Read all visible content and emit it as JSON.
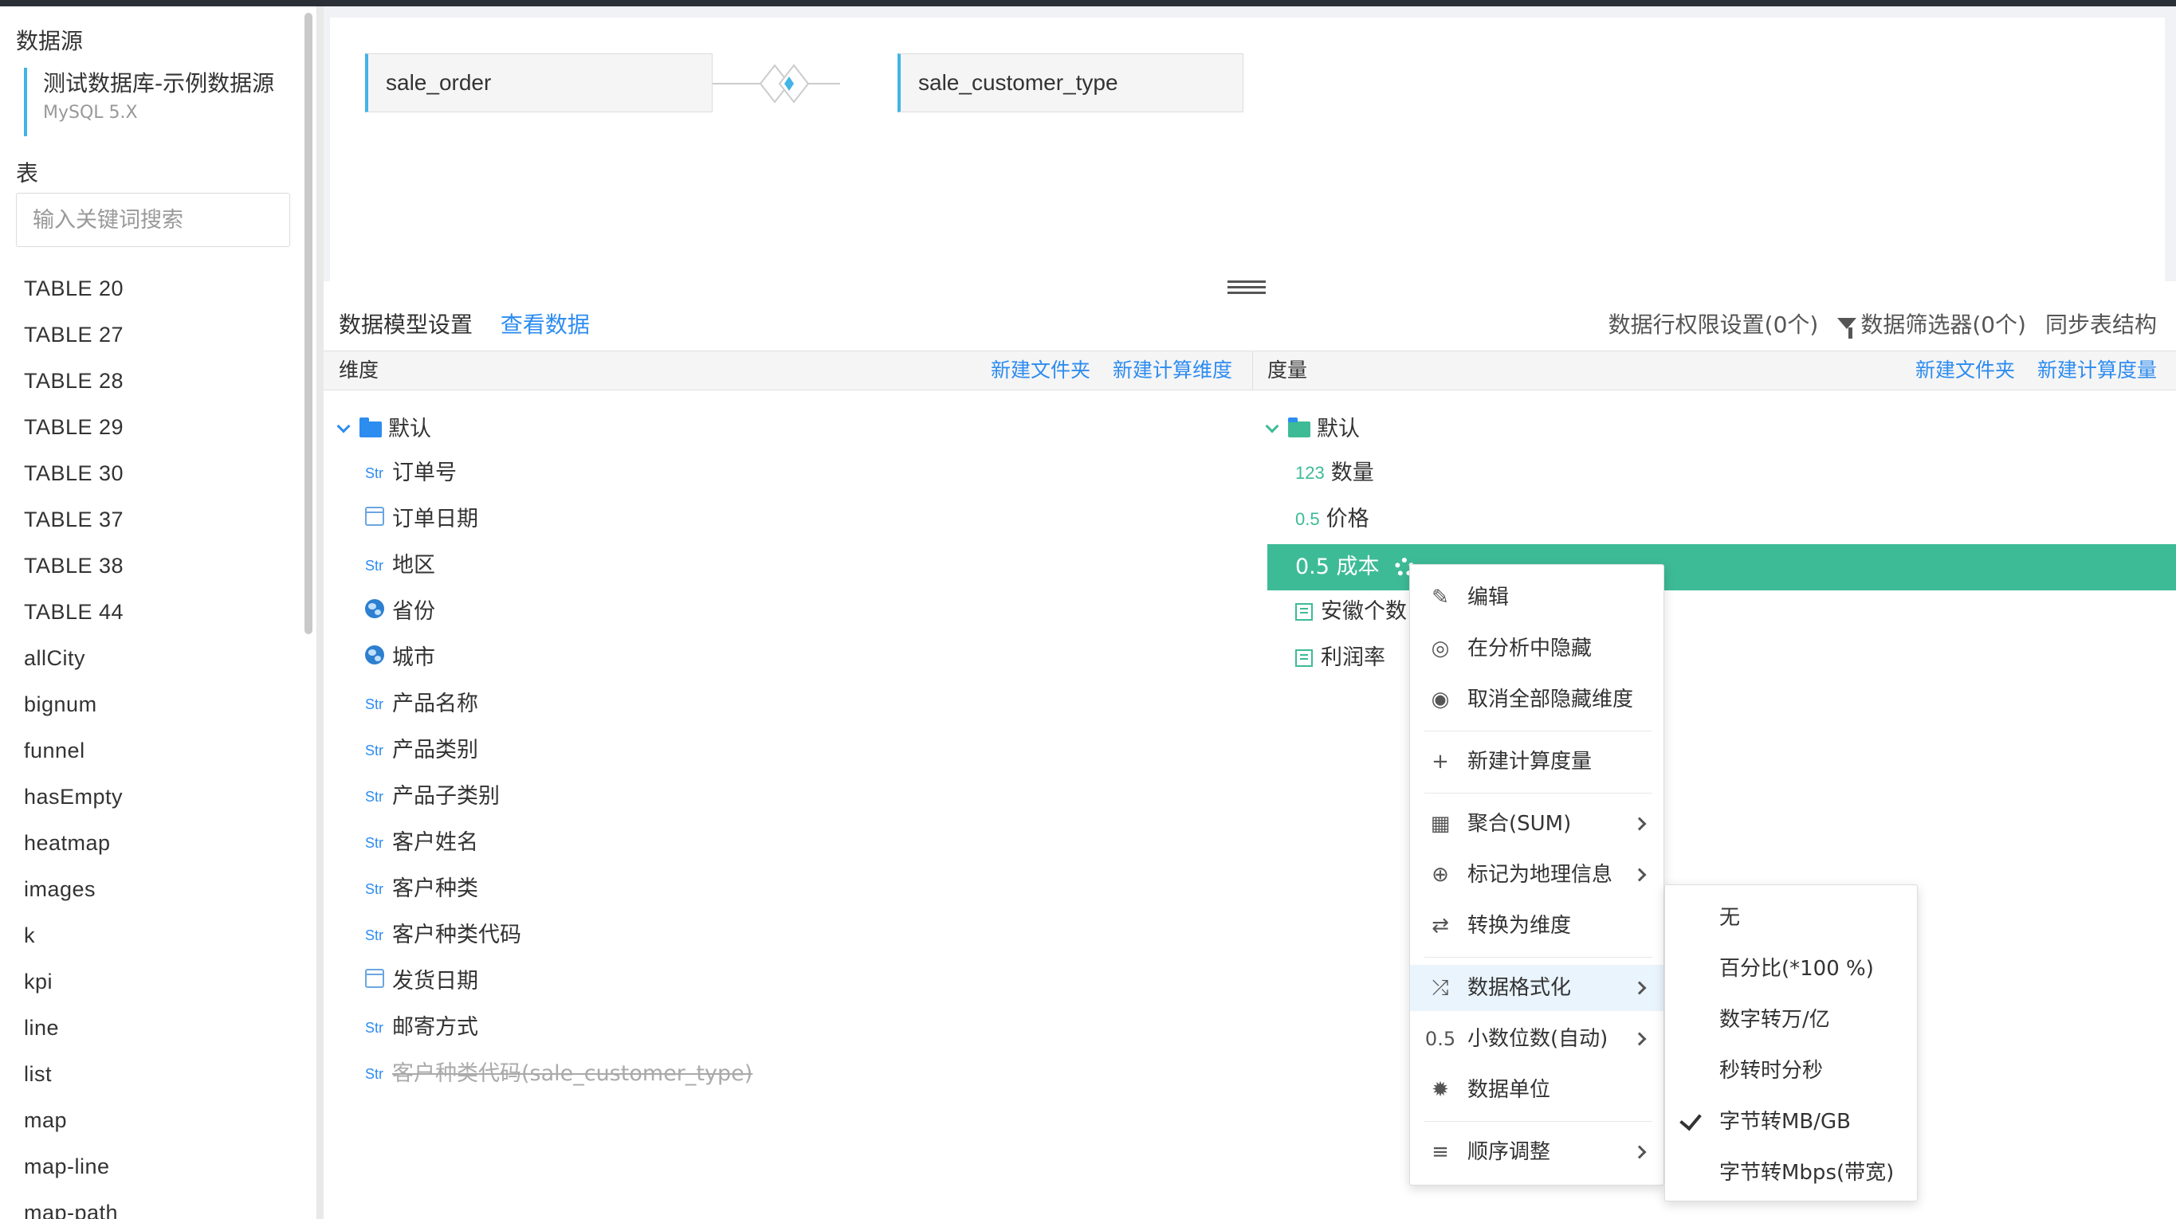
{
  "sidebar": {
    "datasource_title": "数据源",
    "datasource_name": "测试数据库-示例数据源",
    "datasource_version": "MySQL 5.X",
    "table_title": "表",
    "search_placeholder": "输入关键词搜索",
    "tables": [
      "TABLE 20",
      "TABLE 27",
      "TABLE 28",
      "TABLE 29",
      "TABLE 30",
      "TABLE 37",
      "TABLE 38",
      "TABLE 44",
      "allCity",
      "bignum",
      "funnel",
      "hasEmpty",
      "heatmap",
      "images",
      "k",
      "kpi",
      "line",
      "list",
      "map",
      "map-line",
      "map-path"
    ]
  },
  "canvas": {
    "left_table": "sale_order",
    "right_table": "sale_customer_type"
  },
  "tabs": {
    "model_settings": "数据模型设置",
    "view_data": "查看数据"
  },
  "toplinks": {
    "row_permission": "数据行权限设置(0个)",
    "filter": "数据筛选器(0个)",
    "sync": "同步表结构"
  },
  "dimensions": {
    "title": "维度",
    "new_folder": "新建文件夹",
    "new_calc": "新建计算维度",
    "folder": "默认",
    "items": [
      {
        "type": "Str",
        "label": "订单号"
      },
      {
        "type": "date",
        "label": "订单日期"
      },
      {
        "type": "Str",
        "label": "地区"
      },
      {
        "type": "geo",
        "label": "省份"
      },
      {
        "type": "geo",
        "label": "城市"
      },
      {
        "type": "Str",
        "label": "产品名称"
      },
      {
        "type": "Str",
        "label": "产品类别"
      },
      {
        "type": "Str",
        "label": "产品子类别"
      },
      {
        "type": "Str",
        "label": "客户姓名"
      },
      {
        "type": "Str",
        "label": "客户种类"
      },
      {
        "type": "Str",
        "label": "客户种类代码"
      },
      {
        "type": "date",
        "label": "发货日期"
      },
      {
        "type": "Str",
        "label": "邮寄方式"
      },
      {
        "type": "Str",
        "label": "客户种类代码(sale_customer_type)"
      }
    ]
  },
  "measures": {
    "title": "度量",
    "new_folder": "新建文件夹",
    "new_calc": "新建计算度量",
    "folder": "默认",
    "items": [
      {
        "type": "123",
        "label": "数量"
      },
      {
        "type": "0.5",
        "label": "价格"
      },
      {
        "type": "0.5",
        "label": "成本"
      },
      {
        "type": "calc",
        "label": "安徽个数"
      },
      {
        "type": "calc",
        "label": "利润率"
      }
    ]
  },
  "context_menu": {
    "edit": "编辑",
    "hide": "在分析中隐藏",
    "unhide_all": "取消全部隐藏维度",
    "new_calc": "新建计算度量",
    "aggregate": "聚合(SUM)",
    "geo": "标记为地理信息",
    "to_dim": "转换为维度",
    "format": "数据格式化",
    "decimal_icon": "0.5",
    "decimal": "小数位数(自动)",
    "unit": "数据单位",
    "order": "顺序调整"
  },
  "format_submenu": [
    "无",
    "百分比(*100 %)",
    "数字转万/亿",
    "秒转时分秒",
    "字节转MB/GB",
    "字节转Mbps(带宽)"
  ],
  "colors": {
    "accent": "#2d8cf0",
    "selected": "#3dbb96",
    "border": "#42b4e6"
  }
}
